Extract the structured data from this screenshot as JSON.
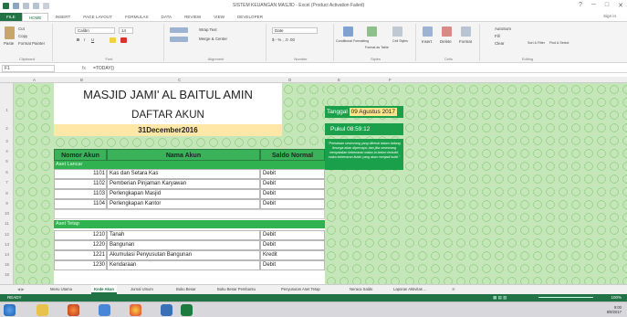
{
  "window": {
    "title": "SISTEM KEUANGAN MASJID - Excel (Product Activation Failed)",
    "controls": [
      "?",
      "─",
      "□",
      "✕"
    ],
    "signin": "Sign in"
  },
  "ribbon_tabs": [
    "FILE",
    "HOME",
    "INSERT",
    "PAGE LAYOUT",
    "FORMULAS",
    "DATA",
    "REVIEW",
    "VIEW",
    "DEVELOPER"
  ],
  "ribbon": {
    "clipboard": {
      "label": "Clipboard",
      "paste": "Paste",
      "cut": "Cut",
      "copy": "Copy",
      "format_painter": "Format Painter"
    },
    "font": {
      "label": "Font",
      "name": "Calibri",
      "size": "14"
    },
    "alignment": {
      "label": "Alignment",
      "wrap": "Wrap Text",
      "merge": "Merge & Center"
    },
    "number": {
      "label": "Number",
      "format": "Date"
    },
    "styles": {
      "label": "Styles",
      "cond": "Conditional Formatting",
      "table": "Format as Table",
      "cell": "Cell Styles"
    },
    "cells": {
      "label": "Cells",
      "insert": "Insert",
      "delete": "Delete",
      "format": "Format"
    },
    "editing": {
      "label": "Editing",
      "autosum": "AutoSum",
      "fill": "Fill",
      "clear": "Clear",
      "sort": "Sort & Filter",
      "find": "Find & Select"
    }
  },
  "formula_bar": {
    "namebox": "F1",
    "fx": "fx",
    "formula": "=TODAY()"
  },
  "columns": [
    "A",
    "B",
    "C",
    "D",
    "E",
    "F"
  ],
  "rows": [
    "1",
    "2",
    "3",
    "4",
    "5",
    "6",
    "7",
    "8",
    "9",
    "10",
    "11",
    "12",
    "13",
    "14",
    "15",
    "16"
  ],
  "sheet": {
    "title1": "MASJID JAMI' AL BAITUL AMIN",
    "title2": "DAFTAR AKUN",
    "date": "31December2016",
    "headers": {
      "nomor": "Nomor Akun",
      "nama": "Nama Akun",
      "saldo": "Saldo Normal"
    },
    "section1": "Aset Lancar",
    "rows1": [
      {
        "no": "1101",
        "nama": "Kas dan Setara Kas",
        "saldo": "Debit"
      },
      {
        "no": "1102",
        "nama": "Pemberian Pinjaman Karyawan",
        "saldo": "Debit"
      },
      {
        "no": "1103",
        "nama": "Perlengkapan Masjid",
        "saldo": "Debit"
      },
      {
        "no": "1104",
        "nama": "Perlengkapan Kantor",
        "saldo": "Debit"
      }
    ],
    "section2": "Aset Tetap",
    "rows2": [
      {
        "no": "1210",
        "nama": "Tanah",
        "saldo": "Debit"
      },
      {
        "no": "1220",
        "nama": "Bangunan",
        "saldo": "Debit"
      },
      {
        "no": "1221",
        "nama": "Akumulasi Penyusutan Bangunan",
        "saldo": "Kredit"
      },
      {
        "no": "1230",
        "nama": "Kendaraan",
        "saldo": "Debit"
      }
    ],
    "tanggal_label": "Tanggal",
    "tanggal_value": "09 Agustus 2017",
    "pukul_label": "Pukul",
    "pukul_value": "08:59:12",
    "note": "\"Perkataan seseorang yang dikenal dalam bidang ilmunya akan dipercaya; dan jika seseorang menyatakan kebenaran walau ia belum terbukti, maka kebenaran itulah yang akan menjadi bukti.\""
  },
  "sheet_tabs": [
    "Menu Utama",
    "Kode Akun",
    "Jurnal Umum",
    "Buku Besar",
    "Buku Besar Pembantu",
    "Penyusutan Aset Tetap",
    "Neraca Saldo",
    "Laporan Aktivitas ..."
  ],
  "status": {
    "ready": "READY",
    "zoom": "100%"
  },
  "taskbar": {
    "time": "9:00",
    "date": "8/9/2017"
  }
}
